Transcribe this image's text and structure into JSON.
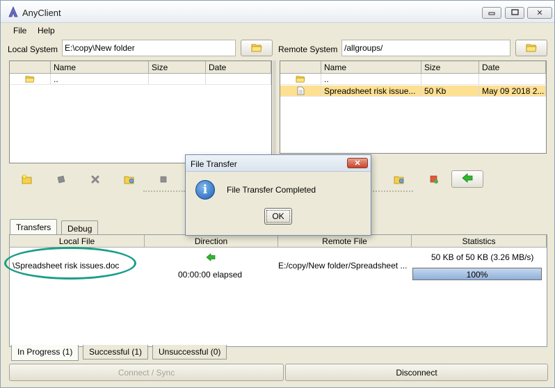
{
  "window": {
    "title": "AnyClient",
    "minimize": "▭",
    "maximize": "◻",
    "close": "✕"
  },
  "menu": {
    "file": "File",
    "help": "Help"
  },
  "local": {
    "label": "Local System",
    "path": "E:\\copy\\New folder",
    "columns": [
      "Name",
      "Size",
      "Date"
    ],
    "rows": [
      {
        "name": "..",
        "size": "",
        "date": ""
      }
    ]
  },
  "remote": {
    "label": "Remote System",
    "path": "/allgroups/",
    "columns": [
      "Name",
      "Size",
      "Date"
    ],
    "rows": [
      {
        "name": "..",
        "size": "",
        "date": ""
      },
      {
        "name": "Spreadsheet risk issue...",
        "size": "50 Kb",
        "date": "May 09 2018 2..."
      }
    ]
  },
  "tabs": {
    "transfers": "Transfers",
    "debug": "Debug"
  },
  "transfers": {
    "columns": [
      "Local File",
      "Direction",
      "Remote File",
      "Statistics"
    ],
    "row": {
      "local_file": "\\Spreadsheet risk issues.doc",
      "elapsed": "00:00:00 elapsed",
      "remote_file": "E:/copy/New folder/Spreadsheet ...",
      "stats": "50 KB of 50 KB (3.26 MB/s)",
      "progress_label": "100%",
      "progress": 100
    }
  },
  "bottom_tabs": {
    "in_progress": "In Progress (1)",
    "successful": "Successful (1)",
    "unsuccessful": "Unsuccessful (0)"
  },
  "buttons": {
    "connect": "Connect / Sync",
    "disconnect": "Disconnect"
  },
  "dialog": {
    "title": "File Transfer",
    "message": "File Transfer Completed",
    "ok": "OK",
    "close": "✕"
  },
  "colors": {
    "accent": "#1a9e87",
    "selection": "#fde092",
    "arrow": "#2eb82e"
  }
}
